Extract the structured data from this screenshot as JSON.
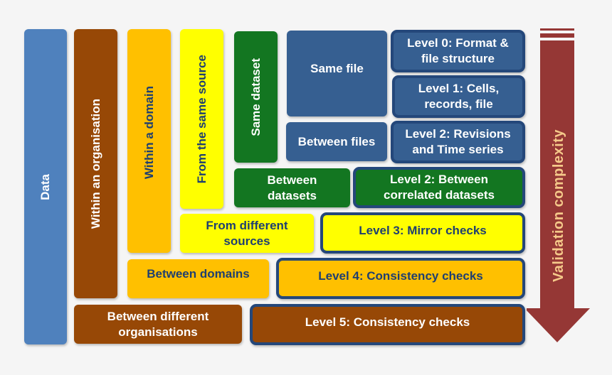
{
  "colors": {
    "data": "#4f81bd",
    "file": "#365f91",
    "organisation": "#974806",
    "domain": "#ffc000",
    "source": "#ffff00",
    "dataset": "#137621",
    "level_border": "#24477a",
    "arrow": "#953735",
    "arrow_text": "#f5c98a",
    "background": "#f5f5f5"
  },
  "columns": {
    "data": "Data",
    "within_organisation": "Within an organisation",
    "within_domain": "Within a domain",
    "same_source": "From the same source",
    "same_dataset": "Same dataset"
  },
  "scopes": {
    "same_file": "Same file",
    "between_files": "Between files",
    "between_datasets": "Between datasets",
    "different_sources": "From different sources",
    "between_domains": "Between domains",
    "between_organisations": "Between different organisations"
  },
  "levels": [
    {
      "label": "Level 0: Format & file structure"
    },
    {
      "label": "Level 1: Cells, records, file"
    },
    {
      "label": "Level 2: Revisions and Time series"
    },
    {
      "label": "Level 2: Between correlated datasets"
    },
    {
      "label": "Level 3: Mirror checks"
    },
    {
      "label": "Level 4: Consistency checks"
    },
    {
      "label": "Level 5: Consistency checks"
    }
  ],
  "arrow": {
    "label": "Validation complexity"
  }
}
